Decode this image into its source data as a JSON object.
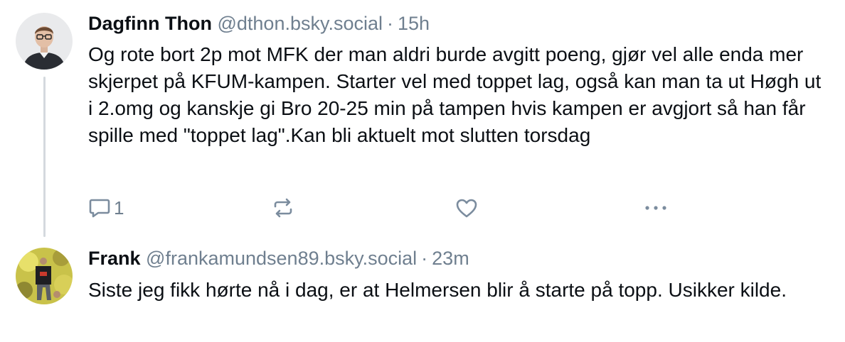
{
  "posts": [
    {
      "author": "Dagfinn Thon",
      "handle": "@dthon.bsky.social",
      "separator": "·",
      "time": "15h",
      "text": "Og rote bort 2p mot MFK der man aldri burde avgitt poeng, gjør vel alle enda mer skjerpet på KFUM-kampen. Starter vel med toppet lag, også kan man ta ut Høgh ut i 2.omg og kanskje gi Bro 20-25 min på tampen hvis kampen er avgjort så han får spille med \"toppet lag\".Kan bli aktuelt mot slutten torsdag",
      "reply_count": "1",
      "icons": {
        "reply": "reply-icon",
        "repost": "repost-icon",
        "like": "heart-icon",
        "more": "more-icon"
      }
    },
    {
      "author": "Frank",
      "handle": "@frankamundsen89.bsky.social",
      "separator": "·",
      "time": "23m",
      "text": "Siste jeg fikk hørte nå i dag, er at Helmersen blir å starte på topp. Usikker kilde."
    }
  ],
  "colors": {
    "text": "#0b0f14",
    "muted": "#6f7f8f",
    "thread_line": "#d4d9de",
    "icon": "#7b8c9e"
  }
}
